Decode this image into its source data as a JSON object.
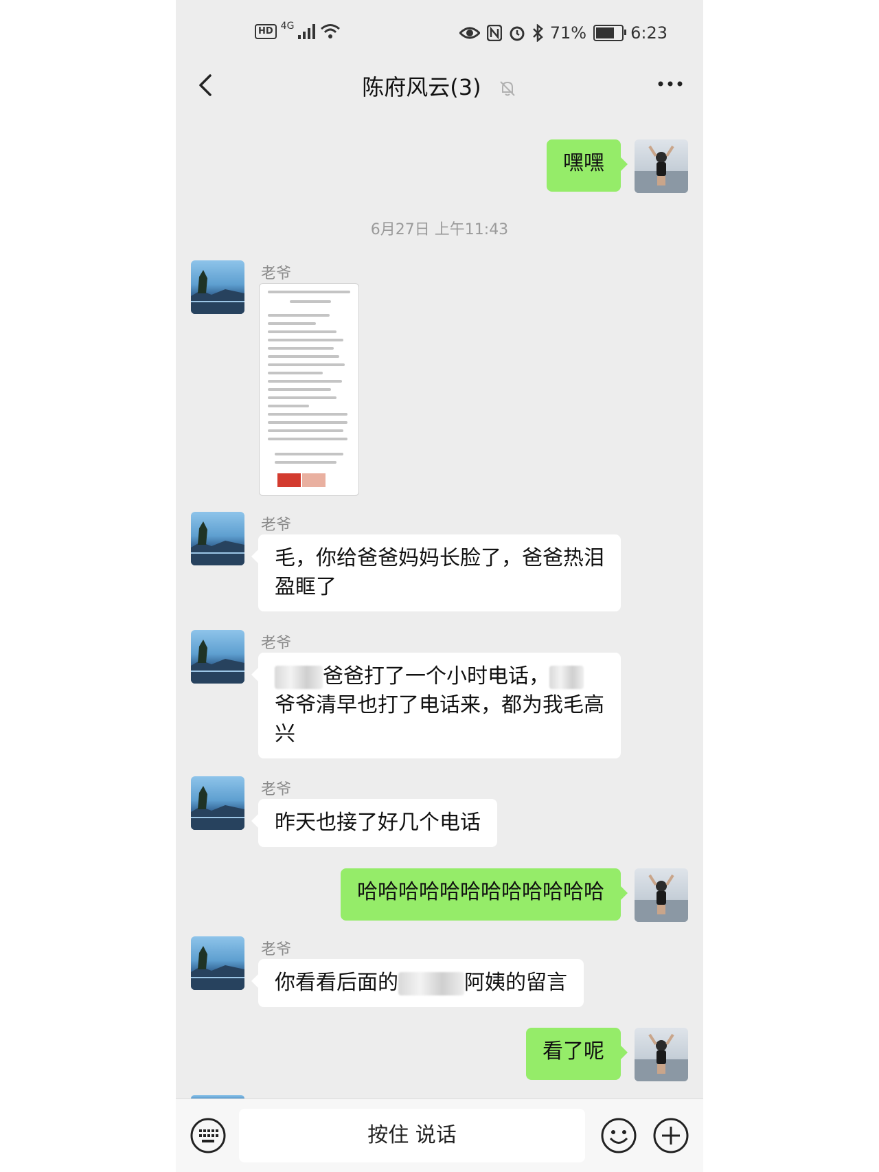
{
  "status": {
    "hd": "HD",
    "network": "4G",
    "battery_percent_text": "71%",
    "battery_level": 0.71,
    "time": "6:23"
  },
  "header": {
    "title": "陈府风云(3)"
  },
  "timestamp": "6月27日 上午11:43",
  "messages": {
    "m1": {
      "text": "嘿嘿"
    },
    "m2": {
      "sender": "老爷"
    },
    "m3": {
      "sender": "老爷",
      "text": "毛，你给爸爸妈妈长脸了，爸爸热泪盈眶了"
    },
    "m4": {
      "sender": "老爷",
      "text_a": "爸爸打了一个小时电话，",
      "text_b": "爷爷清早也打了电话来，都为我毛高兴"
    },
    "m5": {
      "sender": "老爷",
      "text": "昨天也接了好几个电话"
    },
    "m6": {
      "text": "哈哈哈哈哈哈哈哈哈哈哈哈"
    },
    "m7": {
      "sender": "老爷",
      "text_a": "你看看后面的",
      "text_b": "阿姨的留言"
    },
    "m8": {
      "text": "看了呢"
    }
  },
  "input": {
    "hold_to_talk": "按住 说话"
  },
  "colors": {
    "chat_bg": "#ededed",
    "outgoing_bubble": "#95ec69",
    "incoming_bubble": "#ffffff"
  },
  "icons": [
    "back-icon",
    "mute-bell-icon",
    "more-icon",
    "keyboard-icon",
    "emoji-icon",
    "plus-icon",
    "wifi-icon",
    "signal-icon",
    "eye-icon",
    "nfc-icon",
    "alarm-icon",
    "bluetooth-icon",
    "battery-icon"
  ]
}
